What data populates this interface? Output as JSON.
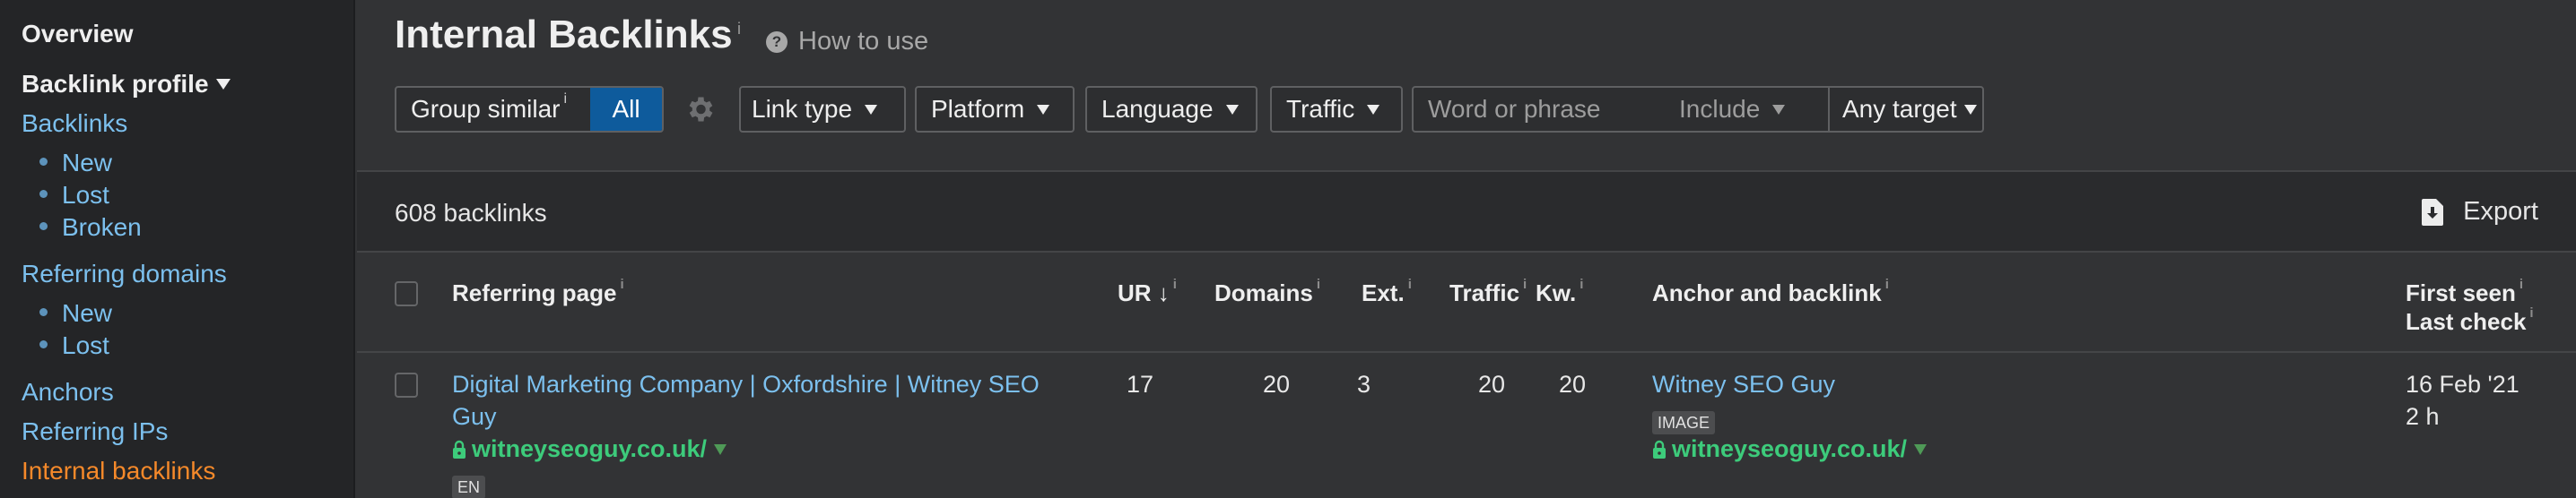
{
  "sidebar": {
    "overview": "Overview",
    "backlink_profile": "Backlink profile",
    "backlinks": "Backlinks",
    "backlinks_sub": [
      "New",
      "Lost",
      "Broken"
    ],
    "referring_domains": "Referring domains",
    "referring_domains_sub": [
      "New",
      "Lost"
    ],
    "anchors": "Anchors",
    "referring_ips": "Referring IPs",
    "internal_backlinks": "Internal backlinks"
  },
  "header": {
    "title": "Internal Backlinks",
    "info": "i",
    "how_to_use": "How to use"
  },
  "filters": {
    "group_similar": "Group similar",
    "group_info": "i",
    "group_value": "All",
    "link_type": "Link type",
    "platform": "Platform",
    "language": "Language",
    "traffic": "Traffic",
    "search_placeholder": "Word or phrase",
    "include": "Include",
    "any_target": "Any target"
  },
  "results": {
    "count": "608 backlinks",
    "export": "Export"
  },
  "table": {
    "columns": {
      "referring_page": "Referring page",
      "ur": "UR",
      "ur_sort": "↓",
      "domains": "Domains",
      "ext": "Ext.",
      "traffic": "Traffic",
      "kw": "Kw.",
      "anchor": "Anchor and backlink",
      "first_seen": "First seen",
      "last_check": "Last check",
      "info": "i"
    },
    "rows": [
      {
        "title_line1": "Digital Marketing Company | Oxfordshire | Witney SEO",
        "title_line2": "Guy",
        "url": "witneyseoguy.co.uk/",
        "lang": "EN",
        "ur": "17",
        "domains": "20",
        "ext": "3",
        "traffic": "20",
        "kw": "20",
        "anchor_text": "Witney SEO Guy",
        "anchor_type": "IMAGE",
        "anchor_url": "witneyseoguy.co.uk/",
        "first_seen": "16 Feb '21",
        "last_check": "2 h"
      }
    ]
  }
}
